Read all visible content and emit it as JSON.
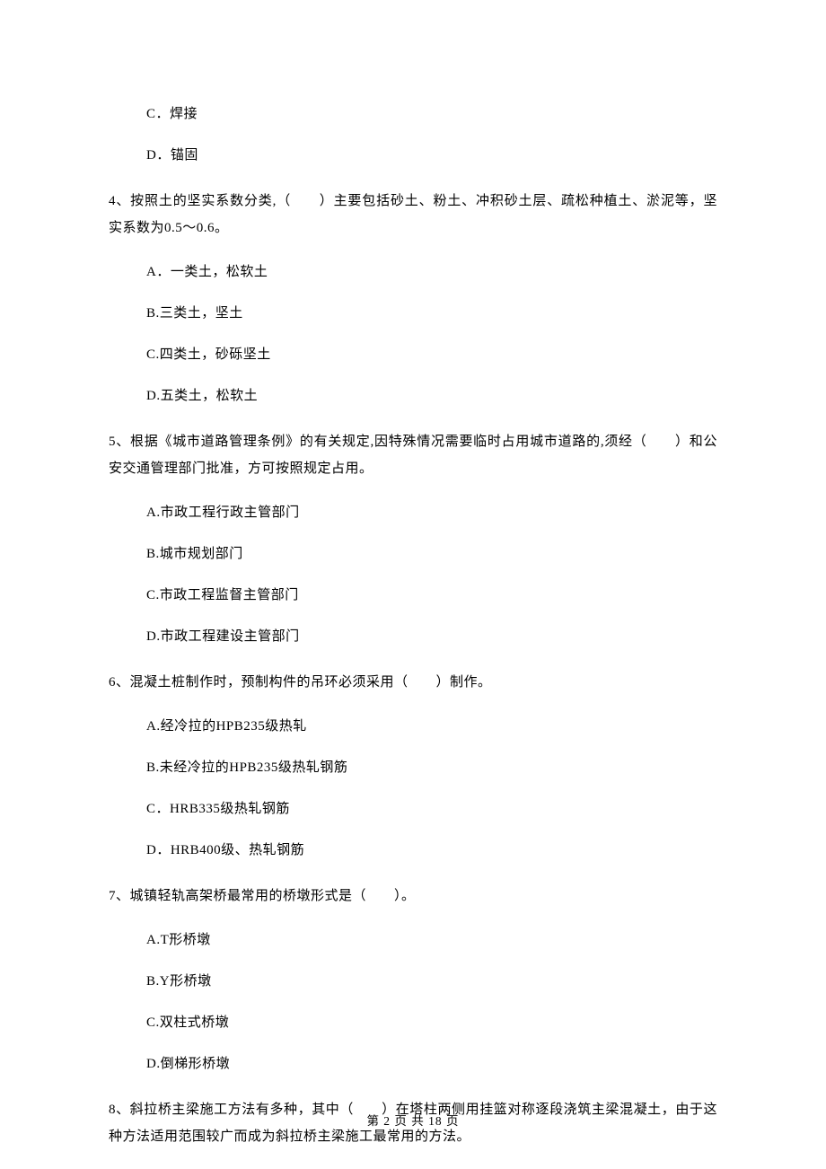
{
  "options_top": {
    "c": "C．焊接",
    "d": "D．锚固"
  },
  "q4": {
    "text": "4、按照土的坚实系数分类,（　　）主要包括砂土、粉土、冲积砂土层、疏松种植土、淤泥等，坚实系数为0.5～0.6。",
    "a": "A．一类土，松软土",
    "b": "B.三类土，坚土",
    "c": "C.四类土，砂砾坚土",
    "d": "D.五类土，松软土"
  },
  "q5": {
    "text": "5、根据《城市道路管理条例》的有关规定,因特殊情况需要临时占用城市道路的,须经（　　）和公安交通管理部门批准，方可按照规定占用。",
    "a": "A.市政工程行政主管部门",
    "b": "B.城市规划部门",
    "c": "C.市政工程监督主管部门",
    "d": "D.市政工程建设主管部门"
  },
  "q6": {
    "text": "6、混凝土桩制作时，预制构件的吊环必须采用（　　）制作。",
    "a": "A.经冷拉的HPB235级热轧",
    "b": "B.未经冷拉的HPB235级热轧钢筋",
    "c": "C．HRB335级热轧钢筋",
    "d": "D．HRB400级、热轧钢筋"
  },
  "q7": {
    "text": "7、城镇轻轨高架桥最常用的桥墩形式是（　　）。",
    "a": "A.T形桥墩",
    "b": "B.Y形桥墩",
    "c": "C.双柱式桥墩",
    "d": "D.倒梯形桥墩"
  },
  "q8": {
    "text": "8、斜拉桥主梁施工方法有多种，其中（　　）在塔柱两侧用挂篮对称逐段浇筑主梁混凝土，由于这种方法适用范围较广而成为斜拉桥主梁施工最常用的方法。"
  },
  "footer": "第 2 页 共 18 页"
}
